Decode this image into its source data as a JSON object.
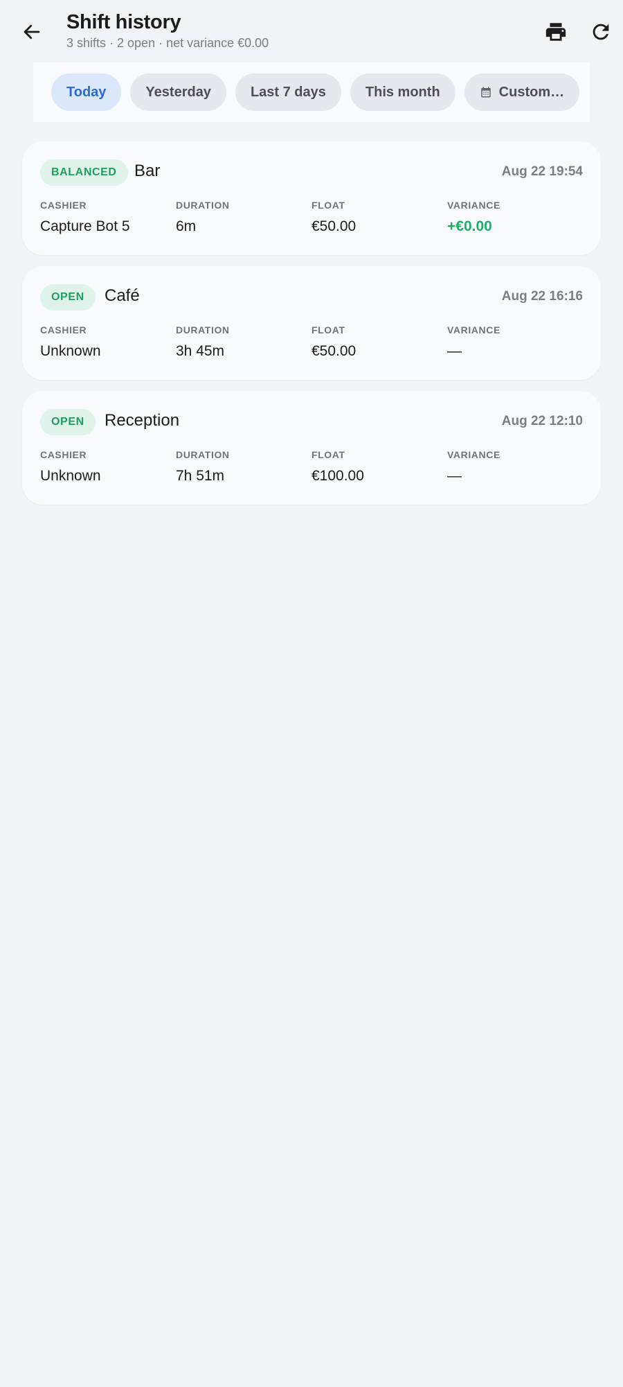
{
  "header": {
    "title": "Shift history",
    "subtitle": "3 shifts · 2 open · net variance €0.00",
    "back_icon": "arrow-left-icon",
    "print_icon": "printer-icon",
    "refresh_icon": "refresh-icon"
  },
  "filters": {
    "chips": [
      {
        "label": "Today",
        "active": true
      },
      {
        "label": "Yesterday",
        "active": false
      },
      {
        "label": "Last 7 days",
        "active": false
      },
      {
        "label": "This month",
        "active": false
      },
      {
        "label": "Custom…",
        "active": false,
        "icon": "calendar-icon"
      }
    ]
  },
  "labels": {
    "cashier": "CASHIER",
    "duration": "DURATION",
    "float": "FLOAT",
    "variance": "VARIANCE"
  },
  "shifts": [
    {
      "status": "BALANCED",
      "name": "Bar",
      "time": "Aug 22 19:54",
      "cashier": "Capture Bot 5",
      "duration": "6m",
      "float": "€50.00",
      "variance": "+€0.00"
    },
    {
      "status": "OPEN",
      "name": "Café",
      "time": "Aug 22 16:16",
      "cashier": "Unknown",
      "duration": "3h 45m",
      "float": "€50.00",
      "variance": "—"
    },
    {
      "status": "OPEN",
      "name": "Reception",
      "time": "Aug 22 12:10",
      "cashier": "Unknown",
      "duration": "7h 51m",
      "float": "€100.00",
      "variance": "—"
    }
  ],
  "colors": {
    "accent": "#2a6bd0",
    "status_green": "#1d9e5f",
    "positive": "#1fae6a",
    "background": "#f2f3f6"
  }
}
